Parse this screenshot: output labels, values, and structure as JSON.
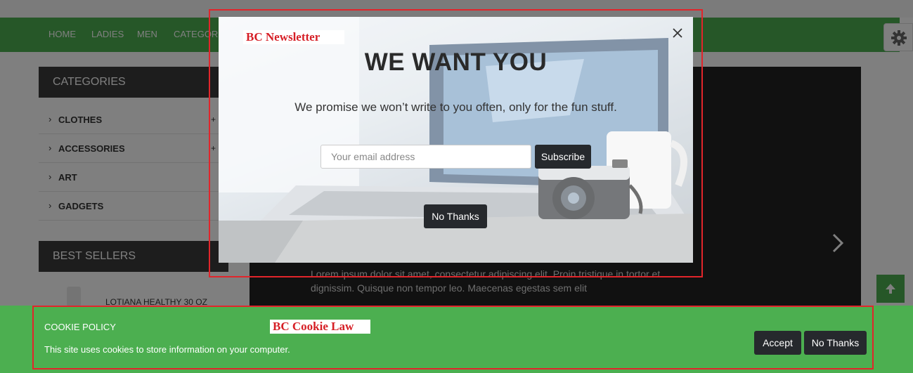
{
  "nav": {
    "items": [
      {
        "label": "HOME"
      },
      {
        "label": "LADIES"
      },
      {
        "label": "MEN"
      },
      {
        "label": "CATEGORIES"
      }
    ]
  },
  "sidebar": {
    "categories_title": "CATEGORIES",
    "categories": [
      {
        "label": "CLOTHES"
      },
      {
        "label": "ACCESSORIES"
      },
      {
        "label": "ART"
      },
      {
        "label": "GADGETS"
      }
    ],
    "best_sellers_title": "BEST SELLERS",
    "best_sellers": [
      {
        "name": "LOTIANA HEALTHY 30 OZ"
      }
    ]
  },
  "slider": {
    "text": "Lorem ipsum dolor sit amet, consectetur adipiscing elit. Proin tristique in tortor et dignissim. Quisque non tempor leo. Maecenas egestas sem elit"
  },
  "newsletter_popup": {
    "callout": "BC Newsletter",
    "title": "WE WANT YOU",
    "subtitle": "We promise we won’t write to you often, only for the fun stuff.",
    "email_placeholder": "Your email address",
    "subscribe_label": "Subscribe",
    "no_thanks_label": "No Thanks"
  },
  "cookie_bar": {
    "callout": "BC Cookie Law",
    "title": "COOKIE POLICY",
    "text": "This site uses cookies to store information on your computer.",
    "accept_label": "Accept",
    "no_thanks_label": "No Thanks"
  },
  "colors": {
    "brand_green": "#4caf50",
    "dark_button": "#26292d",
    "callout_red": "#e1252b"
  }
}
